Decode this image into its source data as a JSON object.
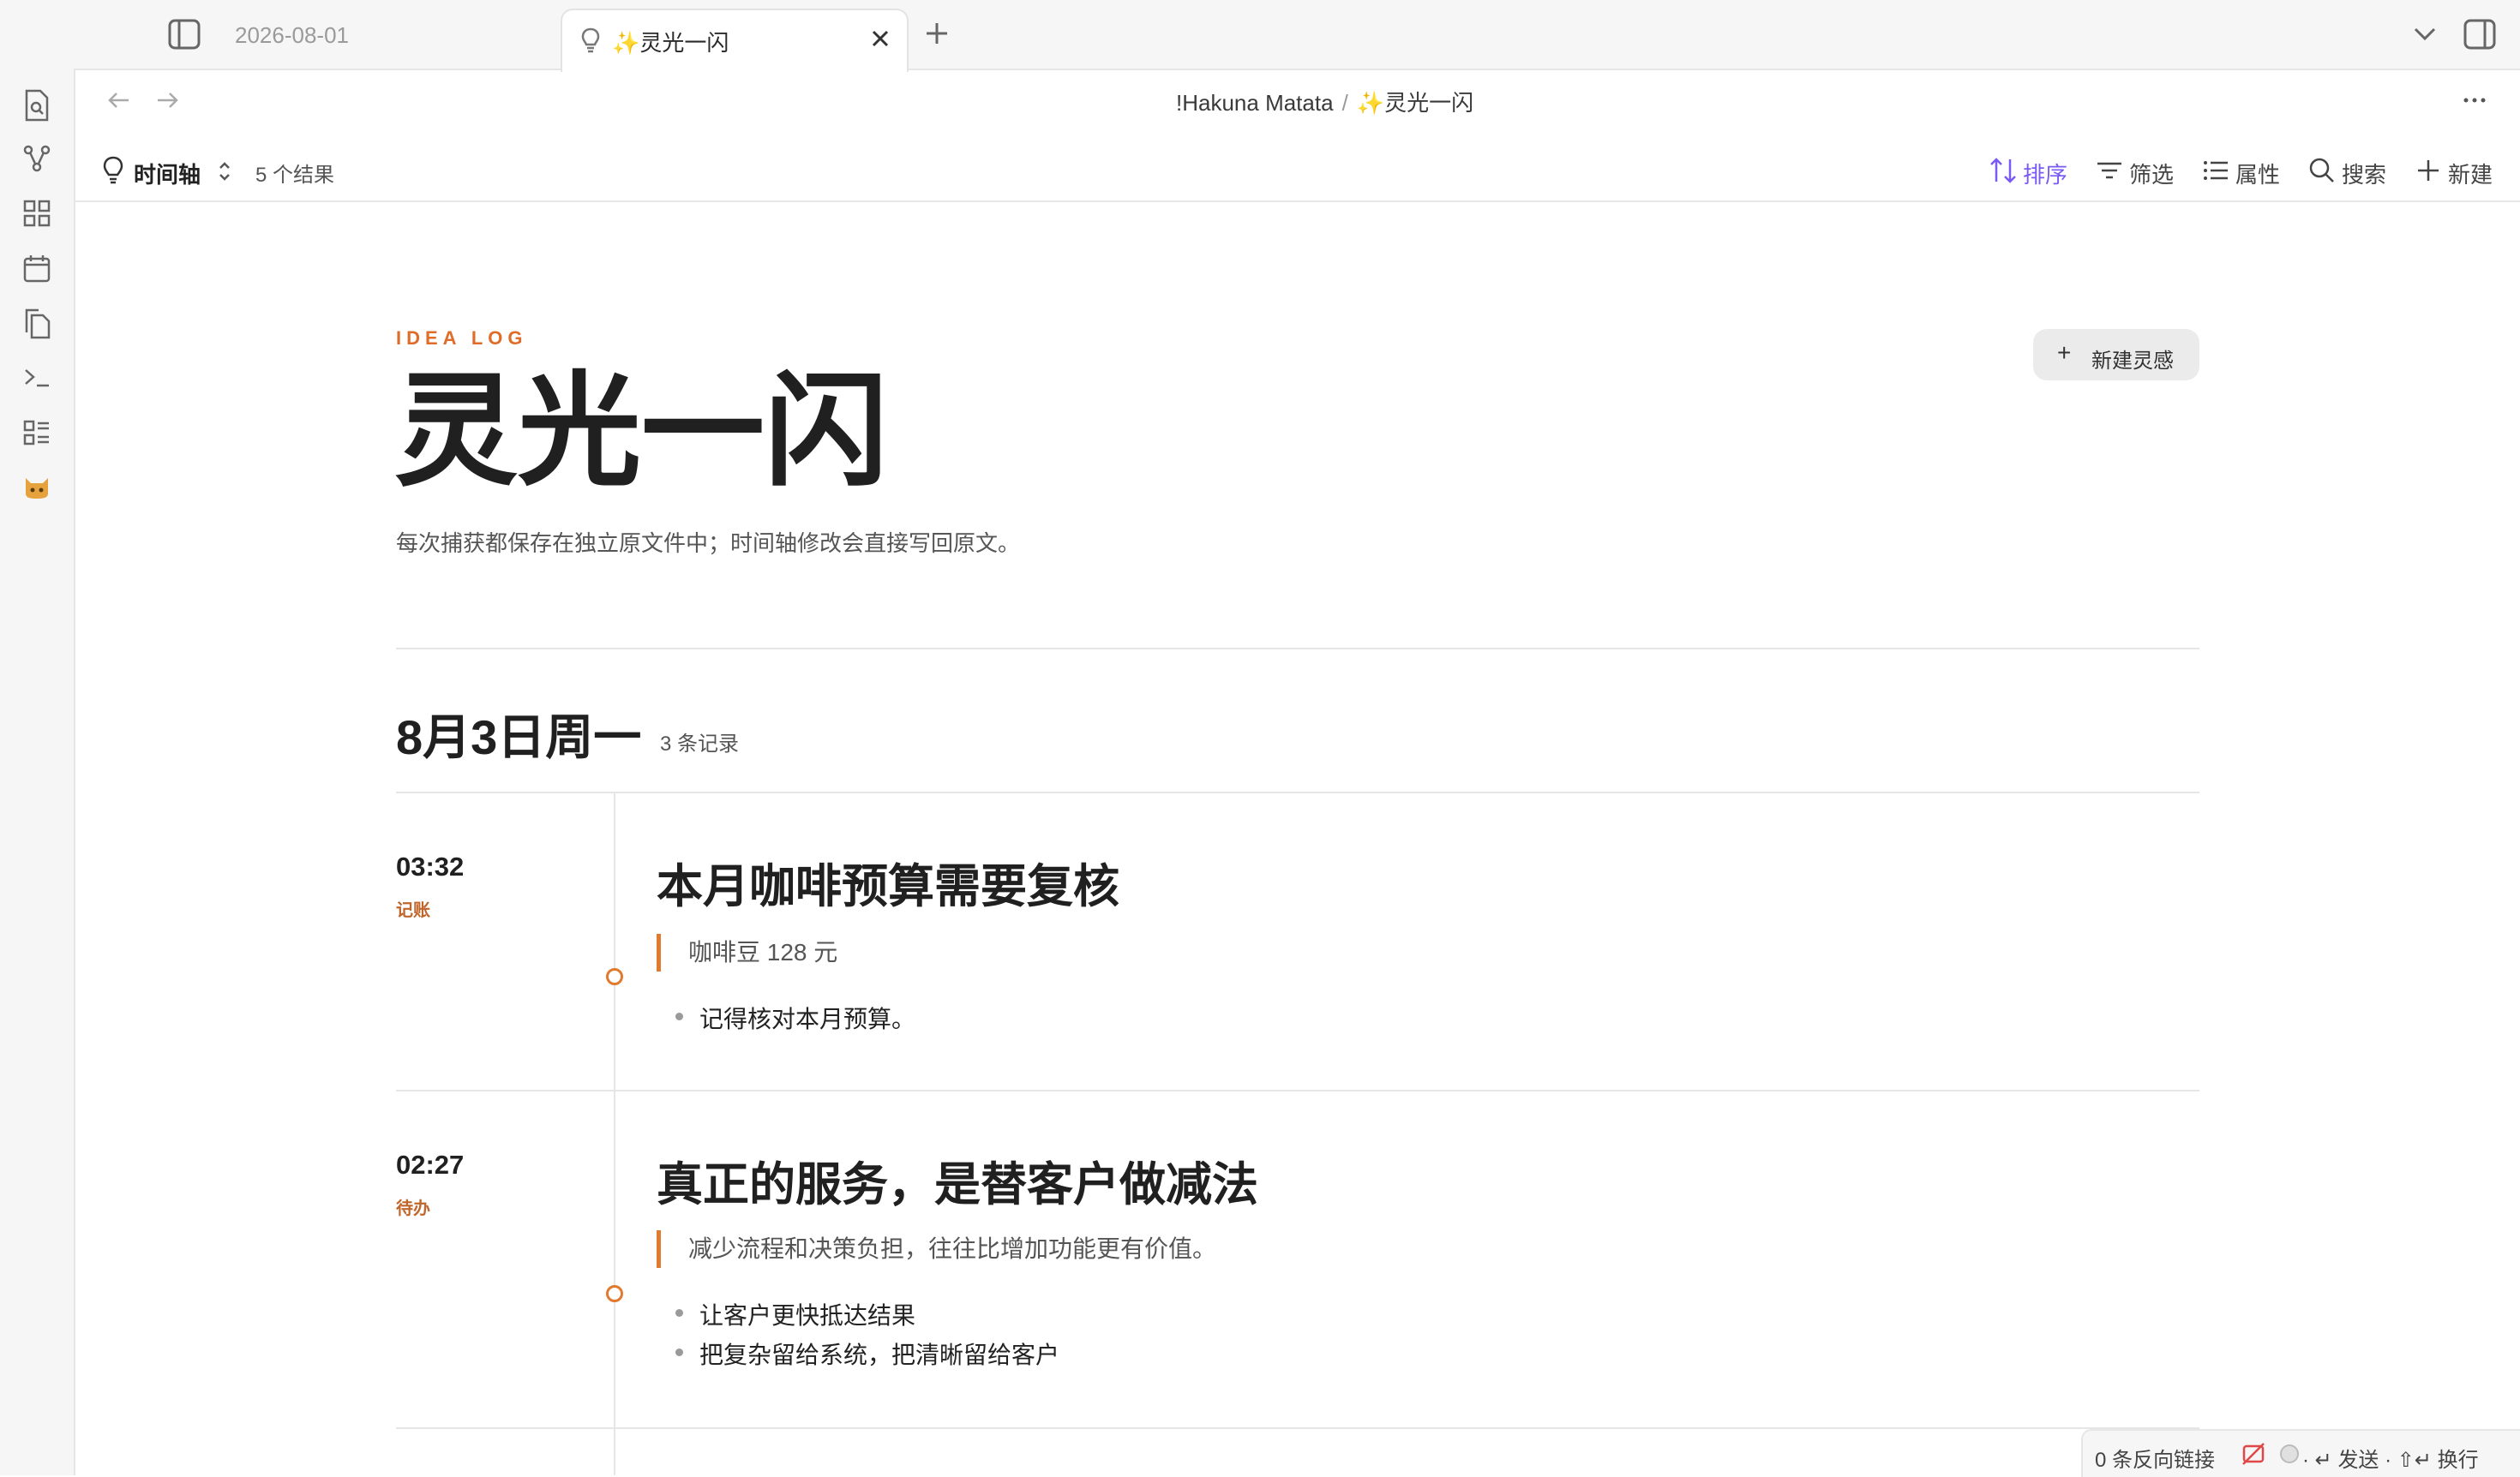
{
  "tabs": [
    {
      "label": "2026-08-01",
      "active": false
    },
    {
      "label": "✨灵光一闪",
      "active": true
    }
  ],
  "breadcrumb": {
    "vault": "!Hakuna Matata",
    "separator": "/",
    "page": "✨灵光一闪"
  },
  "toolbar": {
    "view_name": "时间轴",
    "results": "5 个结果",
    "sort": "排序",
    "filter": "筛选",
    "properties": "属性",
    "search": "搜索",
    "new": "新建"
  },
  "page": {
    "eyebrow": "IDEA LOG",
    "title": "灵光一闪",
    "description": "每次捕获都保存在独立原文件中；时间轴修改会直接写回原文。",
    "new_button": "新建灵感"
  },
  "day": {
    "title": "8月3日周一",
    "count": "3 条记录"
  },
  "entries": [
    {
      "time": "03:32",
      "tag": "记账",
      "title": "本月咖啡预算需要复核",
      "quote": "咖啡豆 128 元",
      "bullets": [
        "记得核对本月预算。"
      ]
    },
    {
      "time": "02:27",
      "tag": "待办",
      "title": "真正的服务，是替客户做减法",
      "quote": "减少流程和决策负担，往往比增加功能更有价值。",
      "bullets": [
        "让客户更快抵达结果",
        "把复杂留给系统，把清晰留给客户"
      ]
    }
  ],
  "status": {
    "backlinks": "0 条反向链接",
    "send_hint": "· ↵ 发送 · ⇧↵ 换行"
  },
  "colors": {
    "accent": "#e06c2a",
    "sort_accent": "#7a5af5"
  }
}
